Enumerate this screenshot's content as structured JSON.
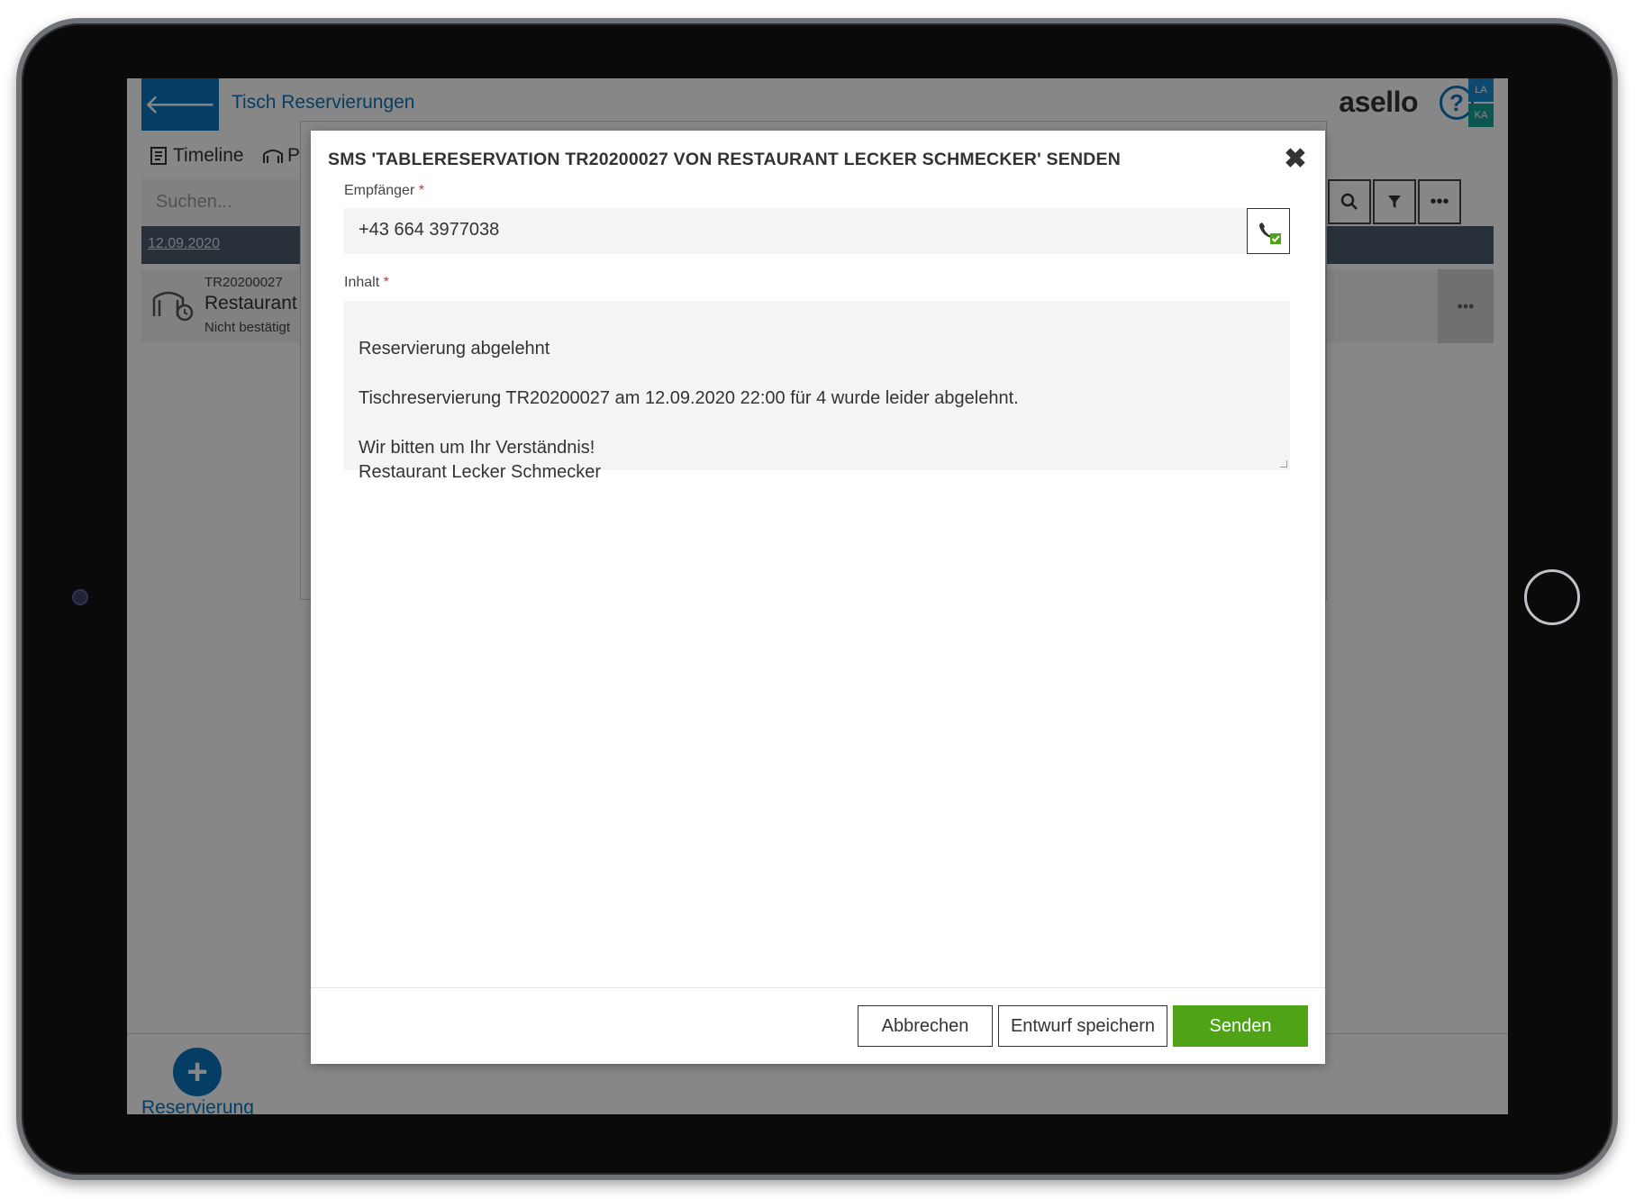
{
  "header": {
    "title": "Tisch Reservierungen",
    "logo_text": "asello",
    "user_badge_top": "LA",
    "user_badge_bottom": "KA",
    "help_glyph": "?"
  },
  "toolbar": {
    "tab_timeline": "Timeline",
    "tab_second_partial": "P",
    "search_placeholder": "Suchen..."
  },
  "list": {
    "date": "12.09.2020",
    "reservation_id": "TR20200027",
    "reservation_name_partial": "Restaurant",
    "reservation_status_partial": "Nicht bestätigt"
  },
  "bottom": {
    "add_label": "Reservierung"
  },
  "dialog": {
    "title": "SMS 'TABLERESERVATION TR20200027 VON RESTAURANT LECKER SCHMECKER' SENDEN",
    "recipient_label": "Empfänger",
    "recipient_value": "+43 664 3977038",
    "content_label": "Inhalt",
    "required_marker": "*",
    "content_value": "Reservierung abgelehnt\n\nTischreservierung TR20200027 am 12.09.2020 22:00 für 4 wurde leider abgelehnt.\n\nWir bitten um Ihr Verständnis!\nRestaurant Lecker Schmecker",
    "buttons": {
      "cancel": "Abbrechen",
      "save_draft": "Entwurf speichern",
      "send": "Senden"
    }
  },
  "colors": {
    "brand_blue": "#0b75bd",
    "send_green": "#4ea416",
    "required_red": "#d32f2f"
  },
  "icons": [
    "back-arrow-icon",
    "timeline-icon",
    "table-icon",
    "search-icon",
    "filter-icon",
    "more-icon",
    "close-icon",
    "phone-check-icon",
    "plus-icon",
    "help-icon"
  ]
}
